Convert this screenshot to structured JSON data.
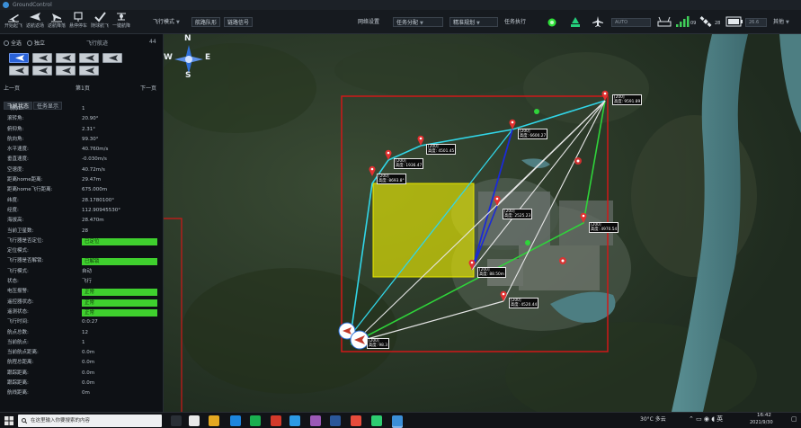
{
  "window": {
    "title": "GroundControl"
  },
  "toolbar": {
    "tools": [
      {
        "name": "start-takeoff",
        "label": "开始起飞"
      },
      {
        "name": "fly-return",
        "label": "返航返场"
      },
      {
        "name": "return-land",
        "label": "返航降落"
      },
      {
        "name": "hover-stop",
        "label": "悬停停车"
      },
      {
        "name": "follow-fly",
        "label": "随球航飞"
      },
      {
        "name": "one-key-land",
        "label": "一键航降"
      }
    ],
    "flight_mode": "飞行模式",
    "route_btn": "航路队形",
    "link_btn": "链路信号",
    "network_label": "网络设置",
    "task_mgmt": "任务分配",
    "precise_plan": "精准规划",
    "exec_label": "任务执行",
    "mode_input": "AUTO",
    "link_count": "09",
    "sat_count": "28",
    "battery": "26.6",
    "other": "其他"
  },
  "sidebar": {
    "all_label": "全选",
    "alone_label": "独立",
    "flight_list_label": "飞行航迹",
    "count": "44",
    "prev": "上一页",
    "page": "第1页",
    "next": "下一页",
    "tabs": [
      "飞机状态",
      "任务显示"
    ],
    "rows": [
      {
        "k": "飞机ID:",
        "v": "1"
      },
      {
        "k": "滚转角:",
        "v": "20.90°"
      },
      {
        "k": "俯仰角:",
        "v": "2.31°"
      },
      {
        "k": "航向角:",
        "v": "99.30°"
      },
      {
        "k": "水平速度:",
        "v": "40.760m/s"
      },
      {
        "k": "垂直速度:",
        "v": "-0.030m/s"
      },
      {
        "k": "空速度:",
        "v": "40.72m/s"
      },
      {
        "k": "距离home距离:",
        "v": "29.47m"
      },
      {
        "k": "距离home飞行距离:",
        "v": "675.000m"
      },
      {
        "k": "纬度:",
        "v": "28.1780100°"
      },
      {
        "k": "经度:",
        "v": "112.90945530°"
      },
      {
        "k": "海拔高:",
        "v": "28.470m"
      },
      {
        "k": "当前卫星数:",
        "v": "28"
      },
      {
        "k": "飞行器是否定位:",
        "v": "已定位",
        "badge": true
      },
      {
        "k": "定位模式:",
        "v": ""
      },
      {
        "k": "飞行器是否解锁:",
        "v": "已解锁",
        "badge": true
      },
      {
        "k": "飞行模式:",
        "v": "自动"
      },
      {
        "k": "状态:",
        "v": "飞行"
      },
      {
        "k": "电压报警:",
        "v": "正常",
        "badge": true
      },
      {
        "k": "遥控器状态:",
        "v": "正常",
        "badge": true
      },
      {
        "k": "遥测状态:",
        "v": "正常",
        "badge": true
      },
      {
        "k": "飞行时间:",
        "v": "0:0:27"
      },
      {
        "k": "航点总数:",
        "v": "12"
      },
      {
        "k": "当前航点:",
        "v": "1"
      },
      {
        "k": "当前航点距离:",
        "v": "0.0m"
      },
      {
        "k": "航程总距离:",
        "v": "0.0m"
      },
      {
        "k": "跟踪距离:",
        "v": "0.0m"
      },
      {
        "k": "跟踪距离:",
        "v": "0.0m"
      },
      {
        "k": "航线距离:",
        "v": "0m"
      }
    ]
  },
  "map": {
    "compass": {
      "n": "N",
      "s": "S",
      "w": "W",
      "e": "E"
    },
    "labels": [
      {
        "t1": "[200]",
        "t2": "高度: 9591.89"
      },
      {
        "t1": "[200]",
        "t2": "高度: 6600.27"
      },
      {
        "t1": "[200]",
        "t2": "高度: 4501.45"
      },
      {
        "t1": "[200]",
        "t2": "高度: 1936.47"
      },
      {
        "t1": "[200]",
        "t2": "高度: 8693.8°"
      },
      {
        "t1": "[200]",
        "t2": "高度: 2525.23"
      },
      {
        "t1": "[200]",
        "t2": "高度: 4970.54"
      },
      {
        "t1": "[200]",
        "t2": "高度: 88.50m"
      },
      {
        "t1": "[200]",
        "t2": "高度: 4520.44"
      },
      {
        "t1": "[200]",
        "t2": "高度: 98.3"
      }
    ]
  },
  "taskbar": {
    "search": "在这里输入你要搜索的内容",
    "weather": "30°C 多云",
    "time": "16:42",
    "date": "2021/9/30"
  },
  "colors": {
    "accent": "#3fd02e",
    "red_box": "#d01818",
    "yellow": "#f2f200"
  }
}
